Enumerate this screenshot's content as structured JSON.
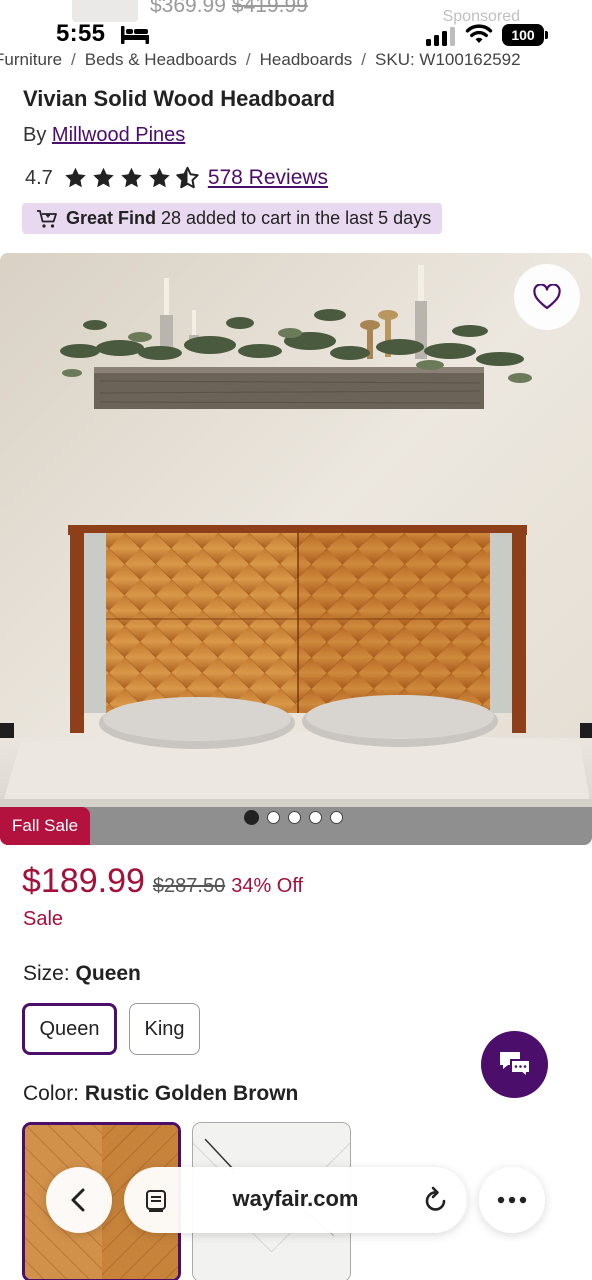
{
  "sponsored": {
    "price": "$369.99",
    "original_price": "$419.99",
    "label": "Sponsored"
  },
  "status_bar": {
    "time": "5:55",
    "battery": "100",
    "icons": [
      "bed-icon",
      "signal-icon",
      "wifi-icon",
      "battery-icon"
    ]
  },
  "breadcrumb": {
    "items": [
      "Furniture",
      "Beds & Headboards",
      "Headboards"
    ],
    "sku": "SKU: W100162592"
  },
  "product": {
    "title": "Vivian Solid Wood Headboard",
    "by_prefix": "By",
    "brand": "Millwood Pines",
    "rating": "4.7",
    "rating_stars": 4.7,
    "reviews": "578 Reviews"
  },
  "great_find": {
    "label": "Great Find",
    "text": "28 added to cart in the last 5 days",
    "icon": "cart-icon"
  },
  "gallery": {
    "sale_tag": "Fall Sale",
    "image_count": 5,
    "active_index": 0,
    "favorite_icon": "heart-icon"
  },
  "pricing": {
    "current": "$189.99",
    "original": "$287.50",
    "discount": "34% Off",
    "sale_label": "Sale"
  },
  "size": {
    "label": "Size:",
    "selected": "Queen",
    "options": [
      "Queen",
      "King"
    ]
  },
  "color": {
    "label": "Color:",
    "selected": "Rustic Golden Brown"
  },
  "browser": {
    "url": "wayfair.com",
    "icons": [
      "back-icon",
      "tabs-icon",
      "reload-icon",
      "more-icon"
    ]
  },
  "colors": {
    "brand_purple": "#4b0f6b",
    "sale_red": "#a3103a",
    "great_find_bg": "#e8d8f0"
  }
}
